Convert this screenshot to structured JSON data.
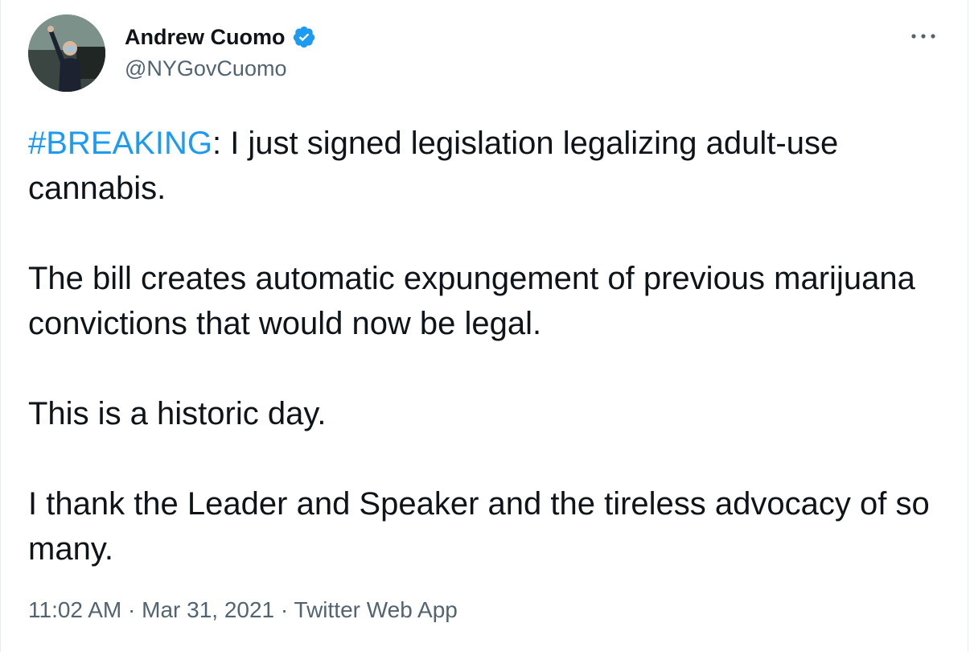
{
  "author": {
    "name": "Andrew Cuomo",
    "handle": "@NYGovCuomo",
    "verified_icon": "verified-badge-icon"
  },
  "menu": {
    "icon": "more-options-icon"
  },
  "tweet": {
    "hashtag": "#BREAKING",
    "line1_rest": ": I just signed legislation legalizing adult-use cannabis.",
    "paragraph2": "The bill creates automatic expungement of previous marijuana convictions that would now be legal.",
    "paragraph3": "This is a historic day.",
    "paragraph4": "I thank the Leader and Speaker and the tireless advocacy of so many."
  },
  "meta": {
    "time": "11:02 AM",
    "separator": " · ",
    "date": "Mar 31, 2021",
    "source": "Twitter Web App"
  },
  "colors": {
    "hashtag": "#1d9bf0",
    "secondary_text": "#536471",
    "verified": "#1d9bf0"
  }
}
